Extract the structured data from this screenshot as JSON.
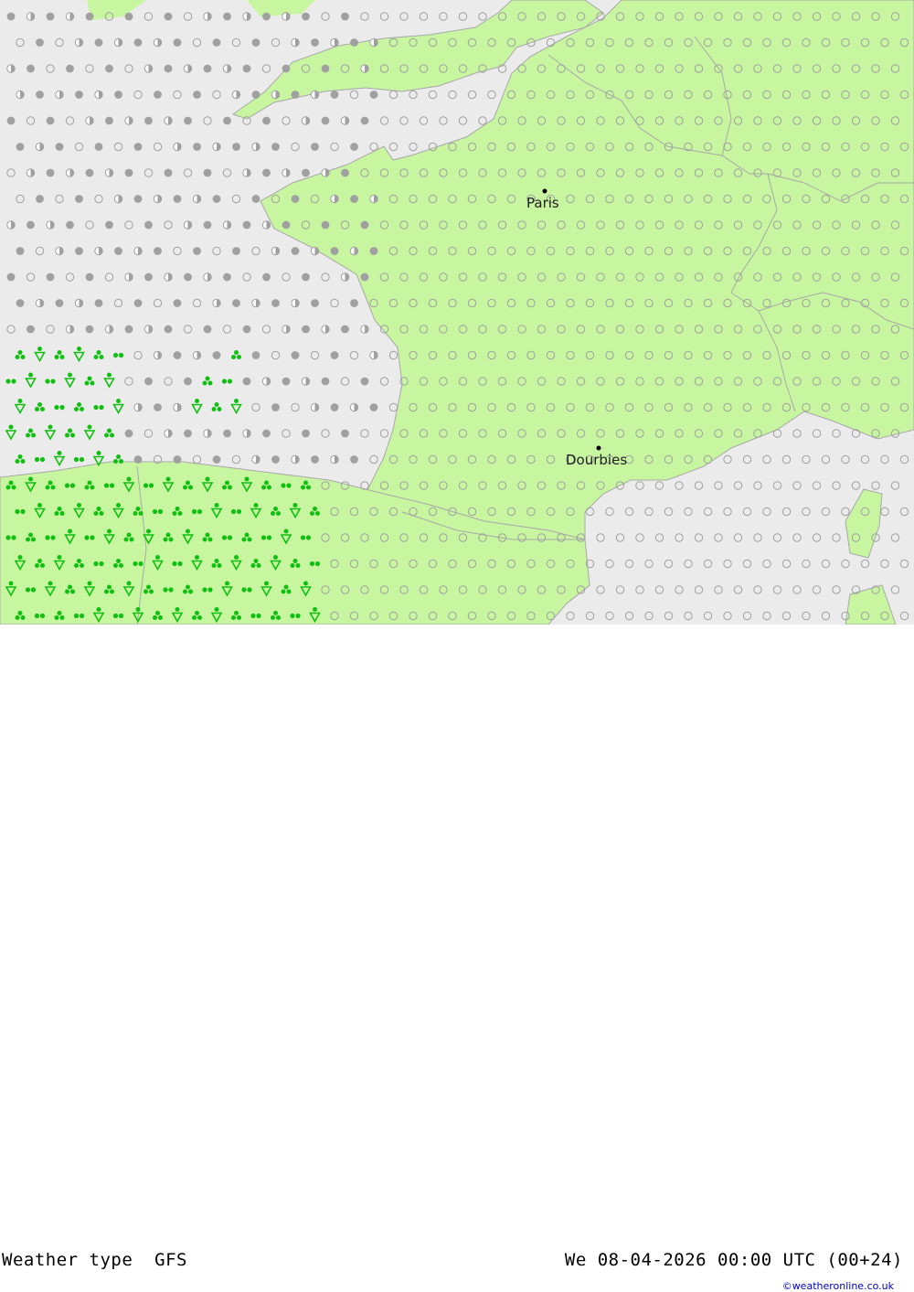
{
  "footer": {
    "product": "Weather type",
    "model": "GFS",
    "valid_time": "We 08-04-2026 00:00 UTC (00+24)",
    "credit": "©weatheronline.co.uk"
  },
  "cities": [
    {
      "name": "Paris"
    },
    {
      "name": "Dourbies"
    }
  ],
  "colors": {
    "sea": "#ebebeb",
    "land": "#c8f5a0",
    "border": "#a8a8a8",
    "symbol_grey": "#a0a0a0",
    "symbol_green": "#10c010"
  },
  "legend_symbols": {
    "open_circle": "cloudy / dry",
    "half_circle": "partly cloudy",
    "filled_circle": "overcast",
    "green_dots": "rain",
    "green_triangle": "showers",
    "green_club": "heavy rain"
  }
}
